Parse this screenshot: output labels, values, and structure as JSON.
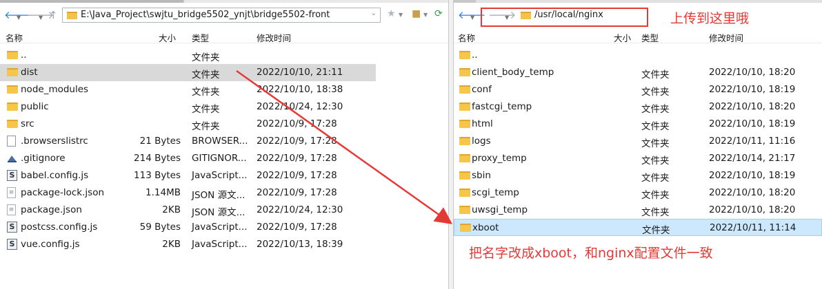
{
  "left": {
    "path": "E:\\Java_Project\\swjtu_bridge5502_ynjt\\bridge5502-front",
    "columns": {
      "name": "名称",
      "size": "大小",
      "type": "类型",
      "modified": "修改时间"
    },
    "rows": [
      {
        "name": "..",
        "size": "",
        "type": "文件夹",
        "modified": "",
        "icon": "folder-icon"
      },
      {
        "name": "dist",
        "size": "",
        "type": "文件夹",
        "modified": "2022/10/10, 21:11",
        "icon": "folder-icon"
      },
      {
        "name": "node_modules",
        "size": "",
        "type": "文件夹",
        "modified": "2022/10/10, 18:38",
        "icon": "folder-icon"
      },
      {
        "name": "public",
        "size": "",
        "type": "文件夹",
        "modified": "2022/10/24, 12:30",
        "icon": "folder-icon"
      },
      {
        "name": "src",
        "size": "",
        "type": "文件夹",
        "modified": "2022/10/9, 17:28",
        "icon": "folder-icon"
      },
      {
        "name": ".browserslistrc",
        "size": "21 Bytes",
        "type": "BROWSER...",
        "modified": "2022/10/9, 17:28",
        "icon": "file-icon"
      },
      {
        "name": ".gitignore",
        "size": "214 Bytes",
        "type": "GITIGNOR...",
        "modified": "2022/10/9, 17:28",
        "icon": "git-icon"
      },
      {
        "name": "babel.config.js",
        "size": "113 Bytes",
        "type": "JavaScript...",
        "modified": "2022/10/9, 17:28",
        "icon": "script-icon"
      },
      {
        "name": "package-lock.json",
        "size": "1.14MB",
        "type": "JSON 源文...",
        "modified": "2022/10/9, 17:28",
        "icon": "json-icon"
      },
      {
        "name": "package.json",
        "size": "2KB",
        "type": "JSON 源文...",
        "modified": "2022/10/24, 12:30",
        "icon": "json-icon"
      },
      {
        "name": "postcss.config.js",
        "size": "59 Bytes",
        "type": "JavaScript...",
        "modified": "2022/10/9, 17:28",
        "icon": "script-icon"
      },
      {
        "name": "vue.config.js",
        "size": "2KB",
        "type": "JavaScript...",
        "modified": "2022/10/13, 18:39",
        "icon": "script-icon"
      }
    ]
  },
  "right": {
    "path": "/usr/local/nginx",
    "columns": {
      "name": "名称",
      "size": "大小",
      "type": "类型",
      "modified": "修改时间"
    },
    "rows": [
      {
        "name": "..",
        "type": "",
        "modified": "",
        "icon": "folder-icon"
      },
      {
        "name": "client_body_temp",
        "type": "文件夹",
        "modified": "2022/10/10, 18:20",
        "icon": "folder-icon"
      },
      {
        "name": "conf",
        "type": "文件夹",
        "modified": "2022/10/10, 18:19",
        "icon": "folder-icon"
      },
      {
        "name": "fastcgi_temp",
        "type": "文件夹",
        "modified": "2022/10/10, 18:20",
        "icon": "folder-icon"
      },
      {
        "name": "html",
        "type": "文件夹",
        "modified": "2022/10/10, 18:19",
        "icon": "folder-icon"
      },
      {
        "name": "logs",
        "type": "文件夹",
        "modified": "2022/10/11, 11:16",
        "icon": "folder-icon"
      },
      {
        "name": "proxy_temp",
        "type": "文件夹",
        "modified": "2022/10/14, 21:17",
        "icon": "folder-icon"
      },
      {
        "name": "sbin",
        "type": "文件夹",
        "modified": "2022/10/10, 18:19",
        "icon": "folder-icon"
      },
      {
        "name": "scgi_temp",
        "type": "文件夹",
        "modified": "2022/10/10, 18:20",
        "icon": "folder-icon"
      },
      {
        "name": "uwsgi_temp",
        "type": "文件夹",
        "modified": "2022/10/10, 18:20",
        "icon": "folder-icon"
      },
      {
        "name": "xboot",
        "type": "文件夹",
        "modified": "2022/10/11, 11:14",
        "icon": "folder-icon"
      }
    ]
  },
  "annotations": {
    "upload_here": "上传到这里哦",
    "rename_note": "把名字改成xboot，和nginx配置文件一致"
  },
  "colors": {
    "annotation": "#e53935",
    "selection_blue": "#cce8ff",
    "selection_gray": "#d9d9d9",
    "folder": "#f6c64a"
  }
}
